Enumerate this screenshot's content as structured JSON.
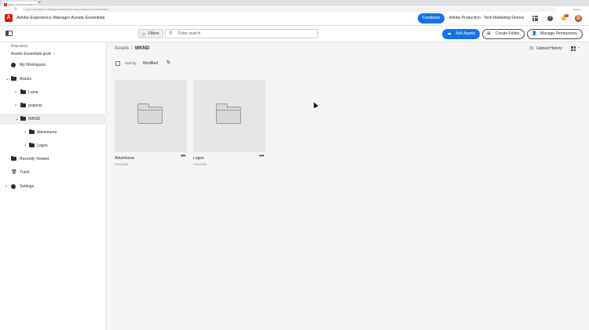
{
  "browser": {
    "tab_title": "Adobe Assets Essentials",
    "tab_close": "×",
    "new_tab": "+",
    "back": "←",
    "forward": "→",
    "reload": "↻",
    "url": "experience.adobe.com/#/@techmarketingdemos/assets/assets-essentials/wknd",
    "profile": "Guest ⋮"
  },
  "header": {
    "logo_letter": "A",
    "app_title": "Adobe Experience Manager Assets Essentials",
    "feedback_label": "Feedback",
    "org_name": "Adobe Production - Tech Marketing Demos",
    "help_glyph": "?",
    "bell_glyph": "🔔",
    "notification_count": "1"
  },
  "toolbar": {
    "filters_icon": "⛉",
    "filters_label": "Filters",
    "search_icon": "⚲",
    "search_placeholder": "Enter search",
    "add_assets_icon": "☁",
    "add_assets_label": "Add Assets",
    "create_folder_icon": "⊞",
    "create_folder_label": "Create Folder",
    "manage_permissions_icon": "👤",
    "manage_permissions_label": "Manage Permissions"
  },
  "sidebar": {
    "repository_label": "Repository",
    "repository_value": "Assets Essentials prod",
    "repository_chevron": "⌄",
    "my_workspace": "My Workspace",
    "assets": "Assets",
    "items": [
      {
        "label": "Luma"
      },
      {
        "label": "projects"
      },
      {
        "label": "WKND"
      },
      {
        "label": "Adventures"
      },
      {
        "label": "Logos"
      }
    ],
    "recently_viewed": "Recently Viewed",
    "trash": "Trash",
    "trash_icon": "🗑",
    "settings": "Settings",
    "chevron_right": "›",
    "chevron_down": "⌄"
  },
  "main": {
    "breadcrumb_root": "Assets",
    "breadcrumb_sep": "/",
    "breadcrumb_current": "WKND",
    "upload_history_icon": "◷",
    "upload_history": "Upload History",
    "view_chevron": "⌄",
    "sort_label": "Sort by",
    "sort_value": "Modified",
    "sort_dir_icon": "⇅",
    "cards": [
      {
        "name": "Adventures",
        "type": "FOLDER",
        "more": "•••"
      },
      {
        "name": "Logos",
        "type": "FOLDER",
        "more": "•••"
      }
    ]
  },
  "colors": {
    "accent": "#1473e6",
    "brand": "#eb1000",
    "badge": "#d7373f"
  }
}
